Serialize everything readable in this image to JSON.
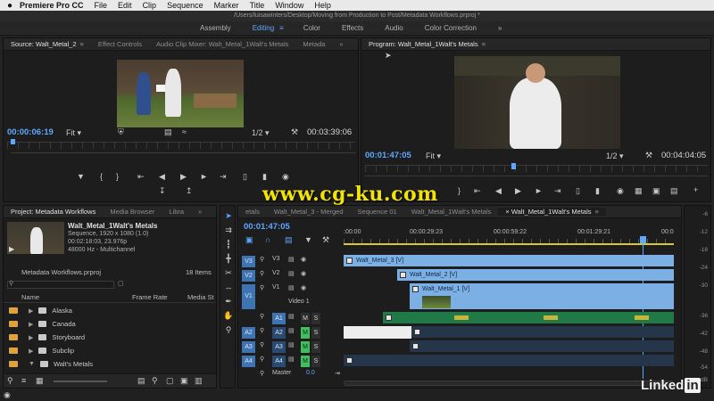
{
  "menubar": {
    "apple": "",
    "app": "Premiere Pro CC",
    "items": [
      "File",
      "Edit",
      "Clip",
      "Sequence",
      "Marker",
      "Title",
      "Window",
      "Help"
    ]
  },
  "window": {
    "path": "/Users/luisawinters/Desktop/Moving from Production to Post/Metadata Workflows.prproj *"
  },
  "workspaces": {
    "items": [
      "Assembly",
      "Editing",
      "Color",
      "Effects",
      "Audio",
      "Color Correction"
    ],
    "active": "Editing",
    "more": "»"
  },
  "source": {
    "tabs": [
      "Source: Walt_Metal_2",
      "Effect Controls",
      "Audio Clip Mixer: Walt_Metal_1Walt's Metals",
      "Metada"
    ],
    "more": "»",
    "timecode": "00:00:06:19",
    "fit": "Fit",
    "resolution": "1/2",
    "duration": "00:03:39:06"
  },
  "program": {
    "title": "Program: Walt_Metal_1Walt's Metals",
    "timecode": "00:01:47:05",
    "fit": "Fit",
    "resolution": "1/2",
    "duration": "00:04:04:05"
  },
  "watermark": "www.cg-ku.com",
  "project": {
    "tabs": [
      "Project: Metadata Workflows",
      "Media Browser",
      "Libra"
    ],
    "more": "»",
    "clip_name": "Walt_Metal_1Walt's Metals",
    "clip_info": [
      "Sequence, 1920 x 1080 (1.0)",
      "00:02:18:03, 23.976p",
      "48000 Hz - Multichannel"
    ],
    "file": "Metadata Workflows.prproj",
    "items_count": "18 Items",
    "columns": [
      "Name",
      "Frame Rate",
      "Media St"
    ],
    "rows": [
      {
        "name": "Alaska",
        "type": "folder"
      },
      {
        "name": "Canada",
        "type": "folder"
      },
      {
        "name": "Storyboard",
        "type": "folder"
      },
      {
        "name": "Subclip",
        "type": "folder"
      },
      {
        "name": "Walt's Metals",
        "type": "folder"
      }
    ]
  },
  "timeline": {
    "tabs": [
      "etals",
      "Walt_Metal_3 - Merged",
      "Sequence 01",
      "Walt_Metal_1Walt's Metals",
      "Walt_Metal_1Walt's Metals"
    ],
    "active_tab": 4,
    "timecode": "00:01:47:05",
    "ruler": [
      ":00:00",
      "00:00:29:23",
      "00:00:59:22",
      "00:01:29:21",
      "00:0"
    ],
    "video_tracks": [
      {
        "src": "V3",
        "name": "V3",
        "label": ""
      },
      {
        "src": "V2",
        "name": "V2",
        "label": ""
      },
      {
        "src": "V1",
        "name": "V1",
        "label": "Video 1"
      }
    ],
    "audio_tracks": [
      {
        "src": "",
        "name": "A1"
      },
      {
        "src": "A2",
        "name": "A2"
      },
      {
        "src": "A3",
        "name": "A3"
      },
      {
        "src": "A4",
        "name": "A4"
      }
    ],
    "master": {
      "label": "Master",
      "value": "0.0"
    },
    "clips": {
      "v3": "Walt_Metal_3 [V]",
      "v2": "Walt_Metal_2 [V]",
      "v1": "Walt_Metal_1 [V]"
    },
    "buttons": {
      "m": "M",
      "s": "S"
    }
  },
  "meters": {
    "scale": [
      "-6",
      "-12",
      "-18",
      "-24",
      "-30",
      "-36",
      "-42",
      "-48",
      "-54"
    ],
    "unit": "dB"
  },
  "brand": {
    "name": "Linked",
    "suffix": "in"
  }
}
